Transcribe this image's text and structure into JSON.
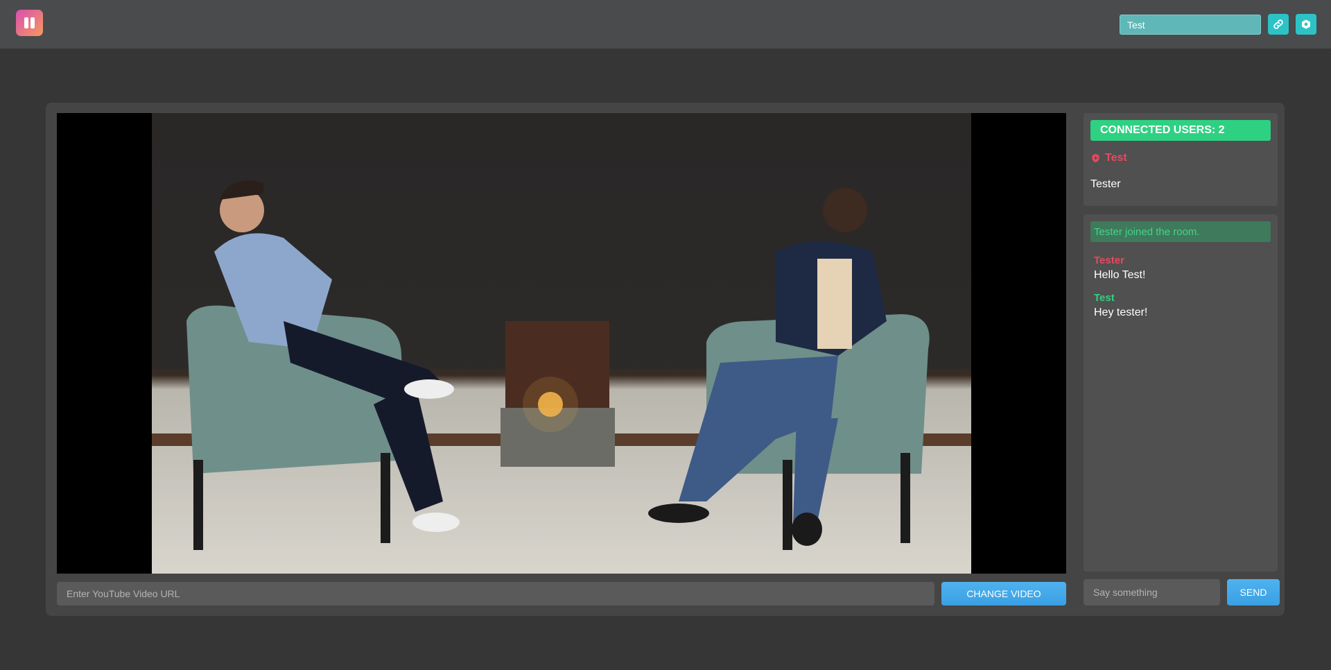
{
  "header": {
    "logo_icon": "pause-logo-icon",
    "username_value": "Test",
    "link_icon": "link-icon",
    "settings_icon": "settings-hexagon-icon",
    "accent_color": "#2cc3c7"
  },
  "video": {
    "url_placeholder": "Enter YouTube Video URL",
    "change_label": "CHANGE VIDEO"
  },
  "users": {
    "count_label": "CONNECTED USERS: 2",
    "list": [
      {
        "name": "Test",
        "role_icon": "shield-icon",
        "is_host": true
      },
      {
        "name": "Tester",
        "is_host": false
      }
    ]
  },
  "chat": {
    "system_message": "Tester joined the room.",
    "messages": [
      {
        "author": "Tester",
        "text": "Hello Test!"
      },
      {
        "author": "Test",
        "text": "Hey tester!"
      }
    ],
    "input_placeholder": "Say something",
    "send_label": "SEND"
  },
  "colors": {
    "host_red": "#e9485f",
    "success_green": "#2ed182",
    "button_blue": "#3aa0e4"
  }
}
